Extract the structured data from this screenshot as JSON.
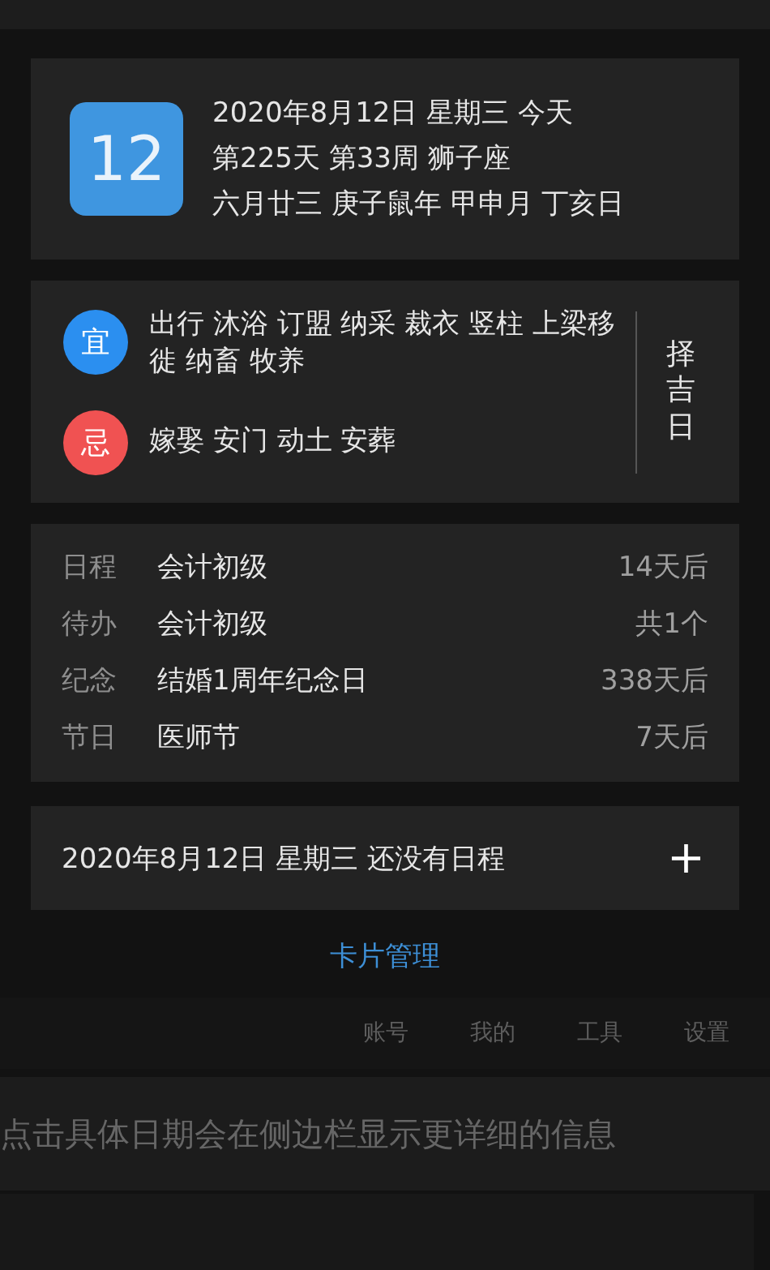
{
  "date_card": {
    "day": "12",
    "lines": [
      "2020年8月12日 星期三 今天",
      "第225天 第33周 狮子座",
      "六月廿三 庚子鼠年 甲申月 丁亥日"
    ]
  },
  "almanac_card": {
    "rows": [
      {
        "kind": "good",
        "badge": "宜",
        "color": "#2b8ff0",
        "text": "出行 沐浴 订盟 纳采 裁衣 竖柱 上梁移徙 纳畜 牧养"
      },
      {
        "kind": "bad",
        "badge": "忌",
        "color": "#f05252",
        "text": "嫁娶 安门 动土 安葬"
      }
    ],
    "side_button": "择吉日"
  },
  "events_card": {
    "rows": [
      {
        "category": "日程",
        "title": "会计初级",
        "when": "14天后"
      },
      {
        "category": "待办",
        "title": "会计初级",
        "when": "共1个"
      },
      {
        "category": "纪念",
        "title": "结婚1周年纪念日",
        "when": "338天后"
      },
      {
        "category": "节日",
        "title": "医师节",
        "when": "7天后"
      }
    ]
  },
  "schedule_card": {
    "text": "2020年8月12日 星期三 还没有日程",
    "add_button": "+"
  },
  "manage_link": "卡片管理",
  "background": {
    "nav_items": [
      "账号",
      "我的",
      "工具",
      "设置"
    ],
    "hint": "点击具体日期会在侧边栏显示更详细的信息"
  }
}
